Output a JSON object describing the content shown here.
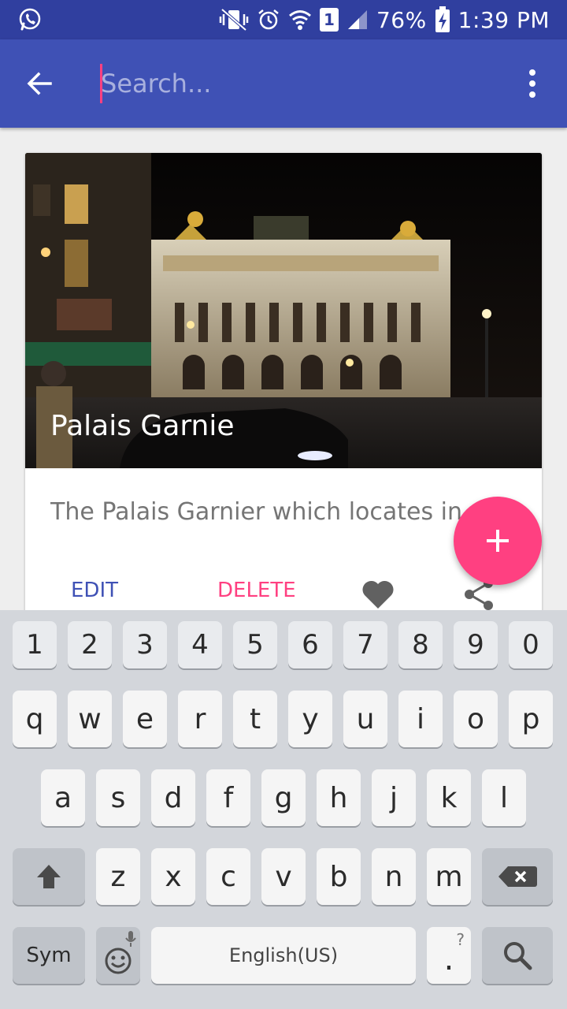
{
  "status_bar": {
    "battery": "76%",
    "time": "1:39 PM",
    "sim": "1",
    "icons": [
      "whatsapp-icon",
      "vibrate-mute-icon",
      "alarm-icon",
      "wifi-icon",
      "sim-icon",
      "signal-icon",
      "battery-charging-icon"
    ]
  },
  "app_bar": {
    "search_placeholder": "Search...",
    "back_icon": "arrow-back-icon",
    "overflow_icon": "more-vert-icon"
  },
  "card": {
    "title": "Palais Garnie",
    "description": "The Palais Garnier which locates in",
    "edit_label": "EDIT",
    "delete_label": "DELETE",
    "favorite_icon": "heart-icon",
    "share_icon": "share-icon"
  },
  "fab": {
    "label": "+"
  },
  "keyboard": {
    "row_numbers": [
      "1",
      "2",
      "3",
      "4",
      "5",
      "6",
      "7",
      "8",
      "9",
      "0"
    ],
    "row1": [
      "q",
      "w",
      "e",
      "r",
      "t",
      "y",
      "u",
      "i",
      "o",
      "p"
    ],
    "row2": [
      "a",
      "s",
      "d",
      "f",
      "g",
      "h",
      "j",
      "k",
      "l"
    ],
    "row3": [
      "z",
      "x",
      "c",
      "v",
      "b",
      "n",
      "m"
    ],
    "sym_label": "Sym",
    "space_label": "English(US)",
    "period_label": ".",
    "period_hint": "?",
    "period_hint2": "\"",
    "emoji_icon": "emoji-icon",
    "mic_icon": "mic-icon",
    "shift_icon": "shift-icon",
    "backspace_icon": "backspace-icon",
    "search_icon": "search-icon"
  },
  "colors": {
    "status_bar": "#303f9f",
    "primary": "#3f51b5",
    "accent": "#ff4081"
  }
}
